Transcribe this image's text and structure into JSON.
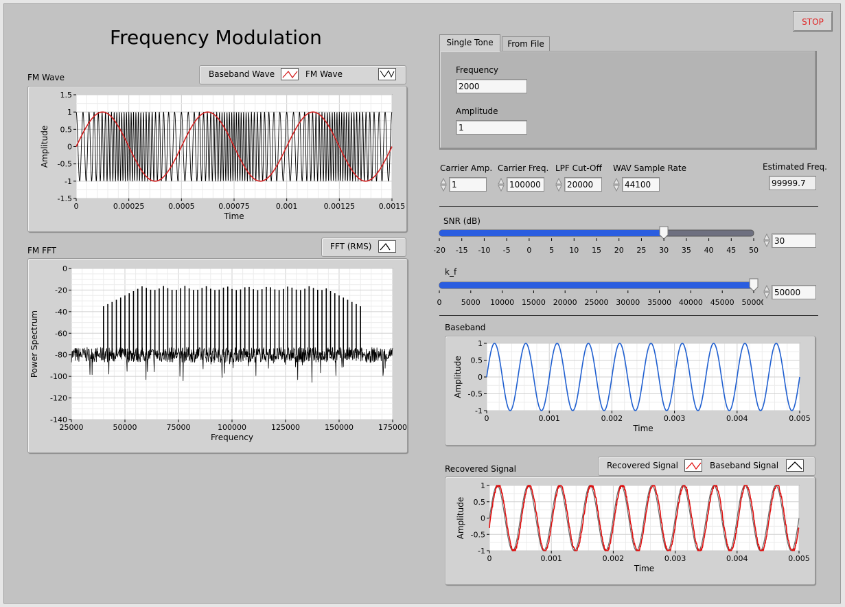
{
  "app": {
    "title": "Frequency Modulation",
    "stop_label": "STOP"
  },
  "colors": {
    "background": "#c2c2c2",
    "baseband_trace": "#1f5fd0",
    "fm_baseband_overlay": "#d42020",
    "recovered_trace": "#e01010",
    "slider_fill": "#2a5de0",
    "stop_text": "#e02020"
  },
  "fm_wave": {
    "label": "FM Wave",
    "legend": [
      "Baseband Wave",
      "FM Wave"
    ],
    "xlabel": "Time",
    "ylabel": "Amplitude",
    "yticks": [
      "1.5",
      "1",
      "0.5",
      "0",
      "-0.5",
      "-1",
      "-1.5"
    ],
    "xticks": [
      "0",
      "0.00025",
      "0.0005",
      "0.00075",
      "0.001",
      "0.00125",
      "0.0015"
    ]
  },
  "fm_fft": {
    "label": "FM FFT",
    "legend": [
      "FFT (RMS)"
    ],
    "xlabel": "Frequency",
    "ylabel": "Power Spectrum",
    "yticks": [
      "0",
      "-20",
      "-40",
      "-60",
      "-80",
      "-100",
      "-120",
      "-140"
    ],
    "xticks": [
      "25000",
      "50000",
      "75000",
      "100000",
      "125000",
      "150000",
      "175000"
    ]
  },
  "tabs": {
    "items": [
      "Single Tone",
      "From File"
    ],
    "active": "Single Tone",
    "frequency_label": "Frequency",
    "frequency_value": "2000",
    "amplitude_label": "Amplitude",
    "amplitude_value": "1"
  },
  "controls": {
    "carrier_amp_label": "Carrier Amp.",
    "carrier_amp_value": "1",
    "carrier_freq_label": "Carrier Freq.",
    "carrier_freq_value": "100000",
    "lpf_label": "LPF Cut-Off",
    "lpf_value": "20000",
    "wav_label": "WAV Sample Rate",
    "wav_value": "44100",
    "est_label": "Estimated Freq.",
    "est_value": "99999.7"
  },
  "snr": {
    "label": "SNR (dB)",
    "value": "30",
    "level": 0.714,
    "ticks": [
      "-20",
      "-15",
      "-10",
      "-5",
      "0",
      "5",
      "10",
      "15",
      "20",
      "25",
      "30",
      "35",
      "40",
      "45",
      "50"
    ]
  },
  "kf": {
    "label": "k_f",
    "value": "50000",
    "level": 1.0,
    "ticks": [
      "0",
      "5000",
      "10000",
      "15000",
      "20000",
      "25000",
      "30000",
      "35000",
      "40000",
      "45000",
      "50000"
    ]
  },
  "baseband": {
    "label": "Baseband",
    "xlabel": "Time",
    "ylabel": "Amplitude",
    "yticks": [
      "1",
      "0.5",
      "0",
      "-0.5",
      "-1"
    ],
    "xticks": [
      "0",
      "0.001",
      "0.002",
      "0.003",
      "0.004",
      "0.005"
    ]
  },
  "recovered": {
    "label": "Recovered Signal",
    "legend": [
      "Recovered Signal",
      "Baseband Signal"
    ],
    "xlabel": "Time",
    "ylabel": "Amplitude",
    "yticks": [
      "1",
      "0.5",
      "0",
      "-0.5",
      "-1"
    ],
    "xticks": [
      "0",
      "0.001",
      "0.002",
      "0.003",
      "0.004",
      "0.005"
    ]
  },
  "chart_data": [
    {
      "type": "line",
      "name": "FM Wave",
      "xlim": [
        0,
        0.0015
      ],
      "ylim": [
        -1.5,
        1.5
      ],
      "series": [
        {
          "name": "Baseband Wave",
          "frequency": 2000,
          "amplitude": 1
        },
        {
          "name": "FM Wave",
          "amplitude": 1,
          "carrier_frequency": 100000
        }
      ]
    },
    {
      "type": "line",
      "name": "FM FFT",
      "xlim": [
        25000,
        175000
      ],
      "ylim": [
        -140,
        0
      ],
      "series": [
        {
          "name": "FFT (RMS)",
          "noise_floor": -80,
          "peak_max": -16,
          "sideband_spacing": 2000,
          "band": [
            40000,
            160000
          ]
        }
      ]
    },
    {
      "type": "line",
      "name": "Baseband",
      "xlim": [
        0,
        0.005
      ],
      "ylim": [
        -1,
        1
      ],
      "series": [
        {
          "frequency": 2000,
          "amplitude": 1
        }
      ]
    },
    {
      "type": "line",
      "name": "Recovered Signal",
      "xlim": [
        0,
        0.005
      ],
      "ylim": [
        -1,
        1
      ],
      "series": [
        {
          "name": "Recovered Signal",
          "frequency": 2000,
          "amplitude": 1
        },
        {
          "name": "Baseband Signal",
          "frequency": 2000,
          "amplitude": 1
        }
      ]
    }
  ]
}
